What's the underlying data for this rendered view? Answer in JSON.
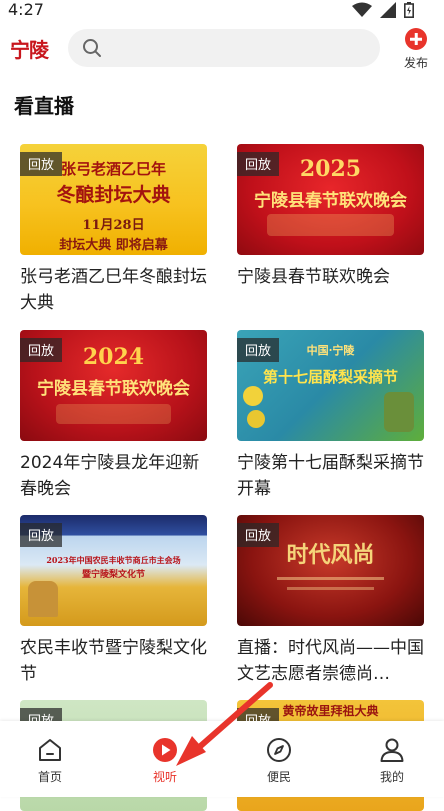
{
  "status": {
    "time": "4:27"
  },
  "header": {
    "logo": "宁陵",
    "publish_label": "发布"
  },
  "section": {
    "title": "看直播"
  },
  "badge_label": "回放",
  "cards": [
    {
      "title": "张弓老酒乙巳年冬酿封坛大典",
      "art_lines": [
        "张弓老酒乙巳年",
        "冬酿封坛大典",
        "11月28日",
        "封坛大典 即将启幕"
      ]
    },
    {
      "title": "宁陵县春节联欢晚会",
      "art_lines": [
        "2025",
        "宁陵县春节联欢晚会"
      ]
    },
    {
      "title": "2024年宁陵县龙年迎新春晚会",
      "art_lines": [
        "2024",
        "宁陵县春节联欢晚会"
      ]
    },
    {
      "title": "宁陵第十七届酥梨采摘节开幕",
      "art_lines": [
        "中国·宁陵",
        "第十七届酥梨采摘节"
      ]
    },
    {
      "title": "农民丰收节暨宁陵梨文化节",
      "art_lines": [
        "2023年中国农民丰收节商丘市主会场",
        "暨宁陵梨文化节"
      ]
    },
    {
      "title": "直播：时代风尚——中国文艺志愿者崇德尚…",
      "art_lines": [
        "时代风尚"
      ]
    },
    {
      "title": "",
      "art_lines": []
    },
    {
      "title": "",
      "art_lines": [
        "黄帝故里拜祖大典"
      ]
    }
  ],
  "nav": [
    {
      "label": "首页",
      "icon": "home-icon"
    },
    {
      "label": "视听",
      "icon": "play-icon"
    },
    {
      "label": "便民",
      "icon": "compass-icon"
    },
    {
      "label": "我的",
      "icon": "user-icon"
    }
  ],
  "colors": {
    "accent": "#e8342b",
    "brand": "#c8161d"
  }
}
